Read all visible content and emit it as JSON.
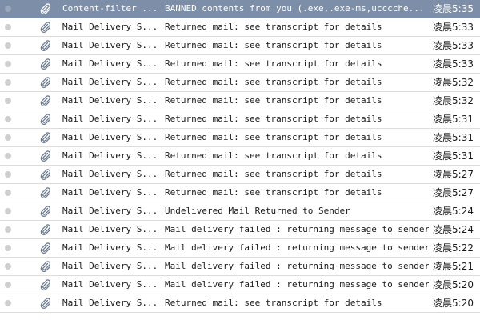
{
  "icons": {
    "status": "unread-dot-icon",
    "attachment": "paperclip-icon"
  },
  "colors": {
    "selected_row": "#7d8ea8",
    "row_border": "#dcdcdc",
    "status_dot": "#cfcfcf"
  },
  "messages": [
    {
      "sender": "Content-filter ...",
      "subject": "BANNED contents from you (.exe,.exe-ms,ucccche...",
      "time": "凌晨5:35"
    },
    {
      "sender": "Mail Delivery S...",
      "subject": "Returned mail: see transcript for details",
      "time": "凌晨5:33"
    },
    {
      "sender": "Mail Delivery S...",
      "subject": "Returned mail: see transcript for details",
      "time": "凌晨5:33"
    },
    {
      "sender": "Mail Delivery S...",
      "subject": "Returned mail: see transcript for details",
      "time": "凌晨5:33"
    },
    {
      "sender": "Mail Delivery S...",
      "subject": "Returned mail: see transcript for details",
      "time": "凌晨5:32"
    },
    {
      "sender": "Mail Delivery S...",
      "subject": "Returned mail: see transcript for details",
      "time": "凌晨5:32"
    },
    {
      "sender": "Mail Delivery S...",
      "subject": "Returned mail: see transcript for details",
      "time": "凌晨5:31"
    },
    {
      "sender": "Mail Delivery S...",
      "subject": "Returned mail: see transcript for details",
      "time": "凌晨5:31"
    },
    {
      "sender": "Mail Delivery S...",
      "subject": "Returned mail: see transcript for details",
      "time": "凌晨5:31"
    },
    {
      "sender": "Mail Delivery S...",
      "subject": "Returned mail: see transcript for details",
      "time": "凌晨5:27"
    },
    {
      "sender": "Mail Delivery S...",
      "subject": "Returned mail: see transcript for details",
      "time": "凌晨5:27"
    },
    {
      "sender": "Mail Delivery S...",
      "subject": "Undelivered Mail Returned to Sender",
      "time": "凌晨5:24"
    },
    {
      "sender": "Mail Delivery S...",
      "subject": "Mail delivery failed : returning message to sender",
      "time": "凌晨5:24"
    },
    {
      "sender": "Mail Delivery S...",
      "subject": "Mail delivery failed : returning message to sender",
      "time": "凌晨5:22"
    },
    {
      "sender": "Mail Delivery S...",
      "subject": "Mail delivery failed : returning message to sender",
      "time": "凌晨5:21"
    },
    {
      "sender": "Mail Delivery S...",
      "subject": "Mail delivery failed : returning message to sender",
      "time": "凌晨5:20"
    },
    {
      "sender": "Mail Delivery S...",
      "subject": "Returned mail: see transcript for details",
      "time": "凌晨5:20"
    }
  ]
}
